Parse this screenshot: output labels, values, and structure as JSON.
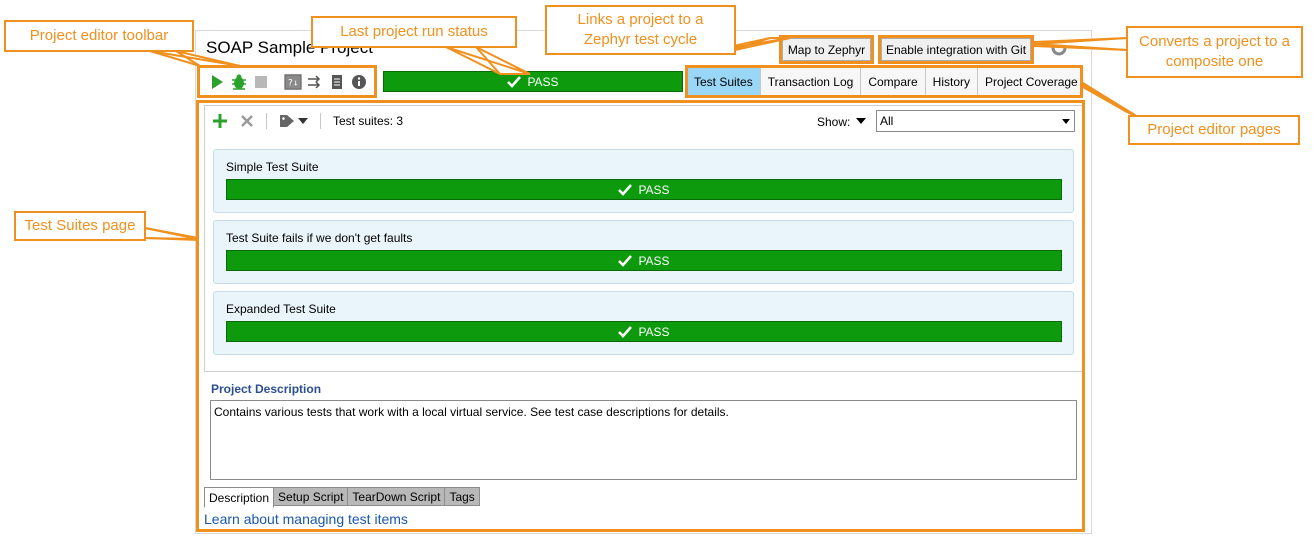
{
  "project": {
    "title": "SOAP Sample Project",
    "run_status": "PASS",
    "map_to_zephyr_label": "Map to Zephyr",
    "enable_git_label": "Enable integration with Git"
  },
  "toolbar": {
    "icons": [
      "run-icon",
      "debug-icon",
      "stop-icon",
      "script-assertion-icon",
      "transfer-icon",
      "log-icon",
      "info-icon"
    ]
  },
  "page_tabs": [
    {
      "label": "Test Suites",
      "active": true
    },
    {
      "label": "Transaction Log",
      "active": false
    },
    {
      "label": "Compare",
      "active": false
    },
    {
      "label": "History",
      "active": false
    },
    {
      "label": "Project Coverage",
      "active": false
    }
  ],
  "suites_toolbar": {
    "count_label": "Test suites: 3",
    "show_label": "Show:",
    "show_value": "All"
  },
  "test_suites": [
    {
      "name": "Simple Test Suite",
      "status": "PASS"
    },
    {
      "name": "Test Suite fails if we don't get faults",
      "status": "PASS"
    },
    {
      "name": "Expanded Test Suite",
      "status": "PASS"
    }
  ],
  "description": {
    "title": "Project Description",
    "text": "Contains various tests that work with a local virtual service. See test case descriptions for details."
  },
  "bottom_tabs": [
    {
      "label": "Description",
      "active": true
    },
    {
      "label": "Setup Script",
      "active": false
    },
    {
      "label": "TearDown Script",
      "active": false
    },
    {
      "label": "Tags",
      "active": false
    }
  ],
  "learn_link": "Learn about managing test items",
  "callouts": {
    "toolbar": "Project editor toolbar",
    "run_status": "Last project run status",
    "zephyr_line1": "Links a project to a",
    "zephyr_line2": "Zephyr test cycle",
    "composite_line1": "Converts a project to a",
    "composite_line2": "composite one",
    "pages": "Project editor pages",
    "suites_page": "Test Suites page"
  },
  "colors": {
    "pass_green": "#0d9b0d",
    "callout_orange": "#f0901e",
    "active_tab": "#9ad6f5",
    "link_blue": "#1a58b0"
  }
}
